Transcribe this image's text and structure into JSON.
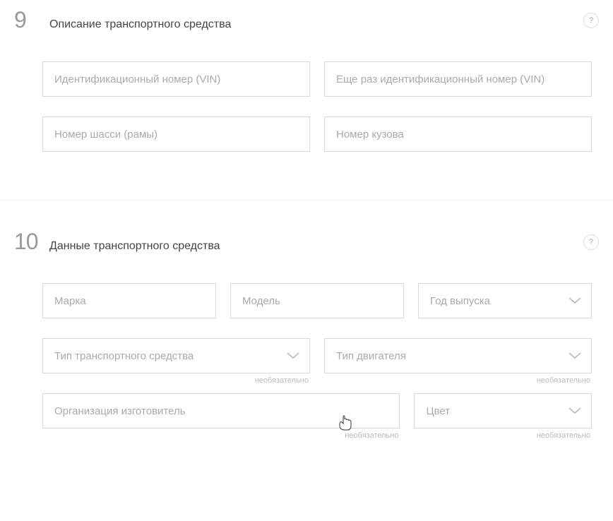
{
  "sections": {
    "s9": {
      "number": "9",
      "title": "Описание транспортного средства",
      "help": "?"
    },
    "s10": {
      "number": "10",
      "title": "Данные транспортного средства",
      "help": "?"
    }
  },
  "fields": {
    "vin": {
      "placeholder": "Идентификационный номер (VIN)"
    },
    "vin2": {
      "placeholder": "Еще раз идентификационный номер (VIN)"
    },
    "chassis": {
      "placeholder": "Номер шасси (рамы)"
    },
    "body": {
      "placeholder": "Номер кузова"
    },
    "brand": {
      "placeholder": "Марка"
    },
    "model": {
      "placeholder": "Модель"
    },
    "year": {
      "label": "Год выпуска"
    },
    "vehicleType": {
      "label": "Тип транспортного средства",
      "hint": "необязательно"
    },
    "engineType": {
      "label": "Тип двигателя",
      "hint": "необязательно"
    },
    "manufacturer": {
      "placeholder": "Организация изготовитель",
      "hint": "необязательно"
    },
    "color": {
      "label": "Цвет",
      "hint": "необязательно"
    }
  }
}
